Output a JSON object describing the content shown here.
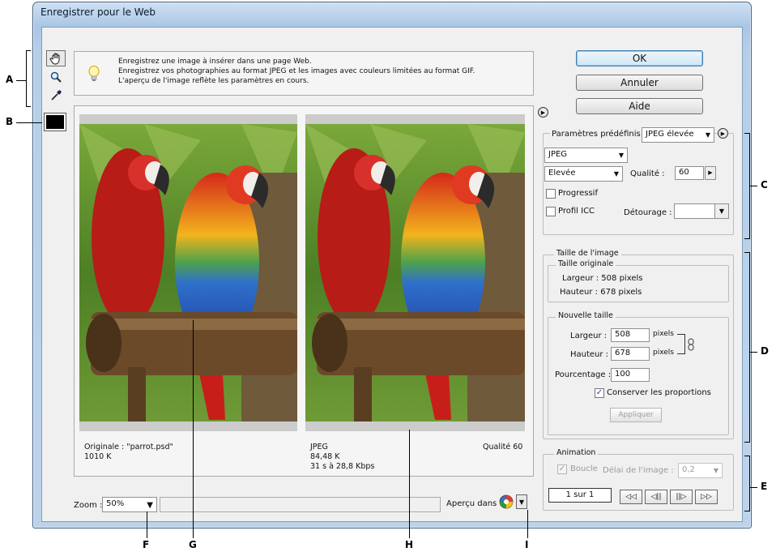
{
  "window": {
    "title": "Enregistrer pour le Web"
  },
  "info": {
    "lines": [
      "Enregistrez une image à insérer dans une page Web.",
      "Enregistrez vos photographies au format JPEG et les images avec couleurs limitées au format GIF.",
      "L'aperçu de l'image reflète les paramètres en cours."
    ]
  },
  "tools": [
    "hand-tool",
    "zoom-tool",
    "eyedropper-tool"
  ],
  "preview": {
    "left": {
      "name": "Originale : \"parrot.psd\"",
      "size": "1010 K"
    },
    "right": {
      "format": "JPEG",
      "size": "84,48 K",
      "time": "31 s à 28,8 Kbps",
      "quality": "Qualité 60"
    }
  },
  "bottom": {
    "zoom_label": "Zoom :",
    "zoom_value": "50%",
    "preview_in": "Aperçu dans :"
  },
  "buttons": {
    "ok": "OK",
    "cancel": "Annuler",
    "help": "Aide"
  },
  "settings": {
    "preset_label": "Paramètres prédéfinis :",
    "preset_value": "JPEG élevée",
    "format": "JPEG",
    "compression": "Elevée",
    "quality_label": "Qualité :",
    "quality_value": "60",
    "progressive": "Progressif",
    "icc": "Profil ICC",
    "matte_label": "Détourage :"
  },
  "image_size": {
    "title": "Taille de l'image",
    "original_title": "Taille originale",
    "original_width": "Largeur : 508 pixels",
    "original_height": "Hauteur : 678 pixels",
    "new_title": "Nouvelle taille",
    "width_label": "Largeur :",
    "width_value": "508",
    "height_label": "Hauteur :",
    "height_value": "678",
    "unit": "pixels",
    "percent_label": "Pourcentage :",
    "percent_value": "100",
    "constrain": "Conserver les proportions",
    "apply": "Appliquer"
  },
  "animation": {
    "title": "Animation",
    "loop": "Boucle",
    "delay_label": "Délai de l'image :",
    "delay_value": "0,2",
    "frame": "1 sur 1",
    "nav": [
      "◁◁",
      "◁||",
      "||▷",
      "▷▷"
    ]
  },
  "callouts": [
    "A",
    "B",
    "C",
    "D",
    "E",
    "F",
    "G",
    "H",
    "I"
  ]
}
